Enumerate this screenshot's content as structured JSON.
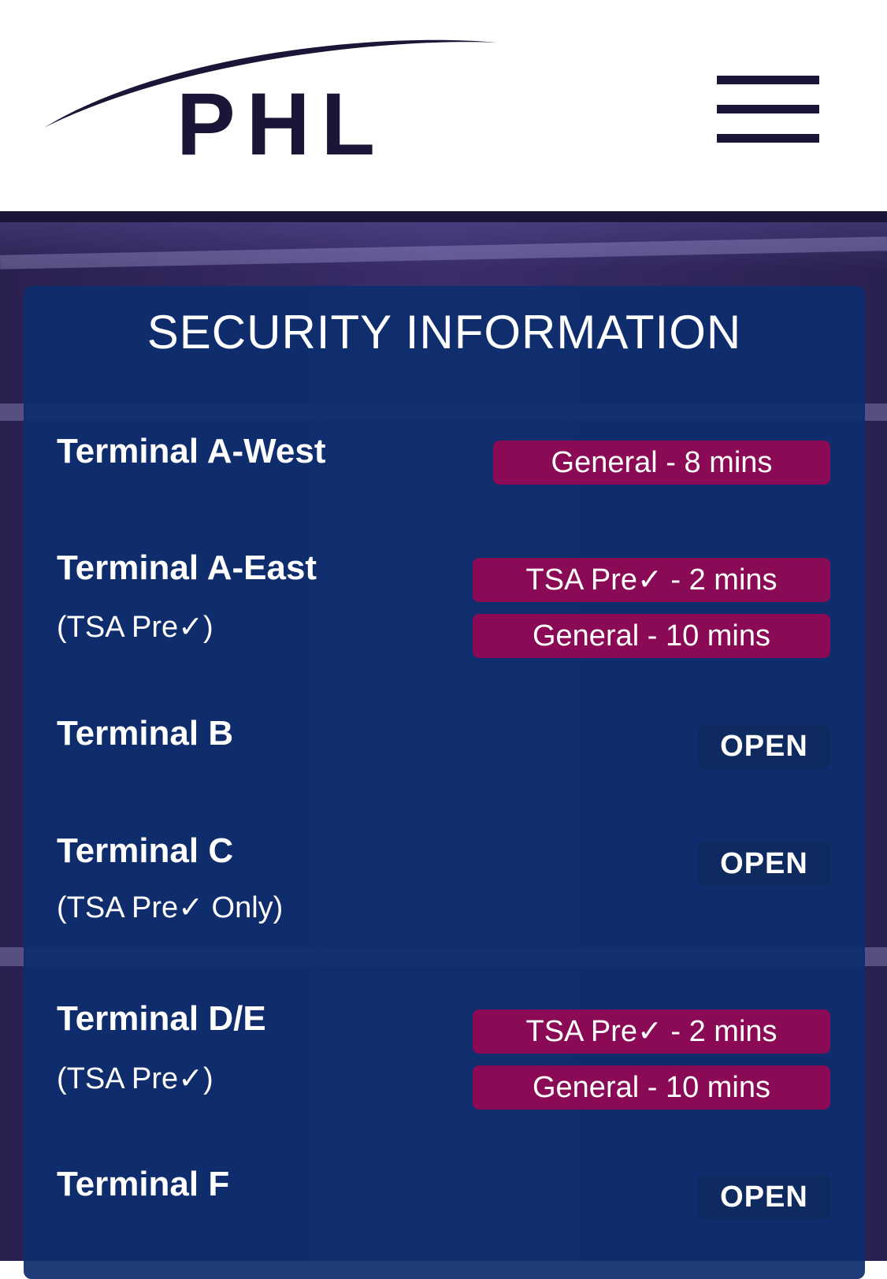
{
  "header": {
    "logo_text": "PHL",
    "menu_icon": "hamburger-menu-icon",
    "colors": {
      "brand": "#1b1537",
      "panel": "#0d2d6e",
      "wait_badge": "#8a0a55",
      "open_badge": "#0e2a5e"
    }
  },
  "security": {
    "title": "SECURITY INFORMATION",
    "terminals": [
      {
        "name": "Terminal A-West",
        "note": "",
        "badges": [
          "General - 8 mins"
        ]
      },
      {
        "name": "Terminal A-East",
        "note": "(TSA Pre✓)",
        "badges": [
          "TSA Pre✓ - 2 mins",
          "General - 10 mins"
        ]
      },
      {
        "name": "Terminal B",
        "note": "",
        "badges": [
          "OPEN"
        ]
      },
      {
        "name": "Terminal C",
        "note": "(TSA Pre✓ Only)",
        "badges": [
          "OPEN"
        ]
      },
      {
        "name": "Terminal D/E",
        "note": "(TSA Pre✓)",
        "badges": [
          "TSA Pre✓ - 2 mins",
          "General - 10 mins"
        ]
      },
      {
        "name": "Terminal F",
        "note": "",
        "badges": [
          "OPEN"
        ]
      }
    ]
  }
}
